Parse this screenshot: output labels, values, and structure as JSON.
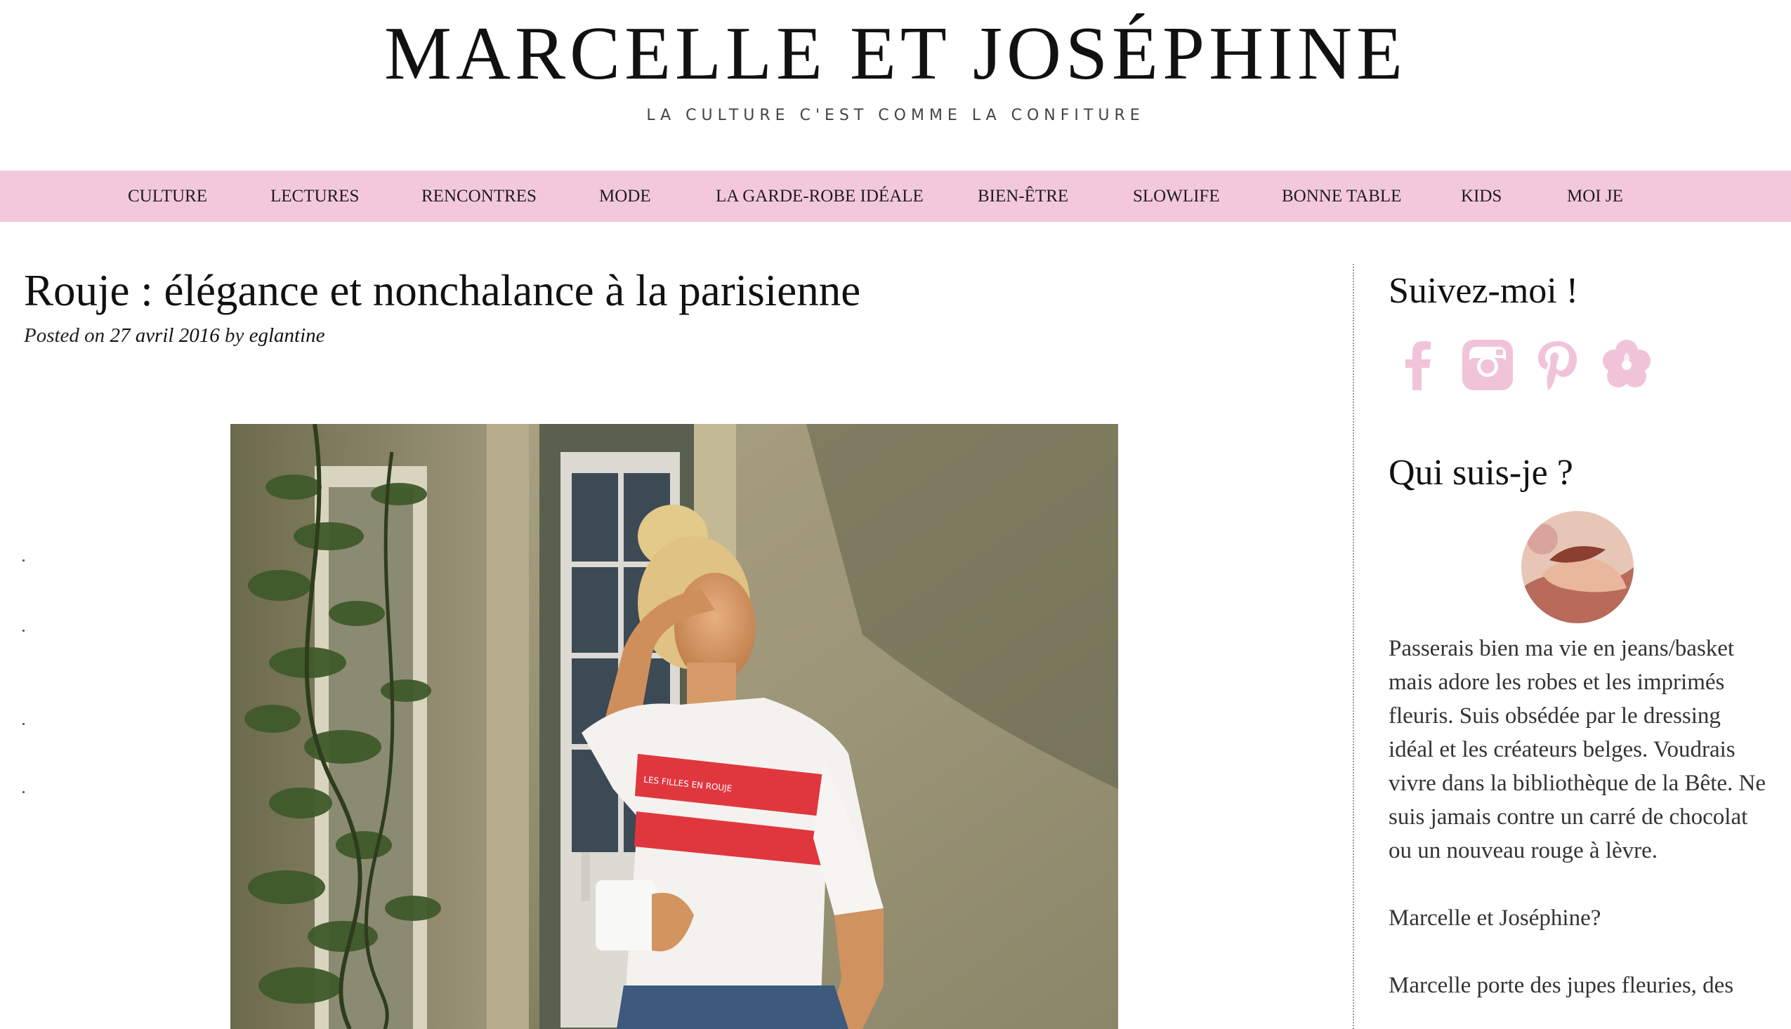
{
  "header": {
    "site_title": "MARCELLE ET JOSÉPHINE",
    "tagline": "LA CULTURE C'EST COMME LA CONFITURE"
  },
  "nav": {
    "items": [
      {
        "label": "CULTURE"
      },
      {
        "label": "LECTURES"
      },
      {
        "label": "RENCONTRES"
      },
      {
        "label": "MODE"
      },
      {
        "label": "LA GARDE-ROBE IDÉALE"
      },
      {
        "label": "BIEN-ÊTRE"
      },
      {
        "label": "SLOWLIFE"
      },
      {
        "label": "BONNE TABLE"
      },
      {
        "label": "KIDS"
      },
      {
        "label": "MOI JE"
      }
    ]
  },
  "article": {
    "title": "Rouje : élégance et nonchalance à la parisienne",
    "posted_on_label": "Posted on",
    "date": "27 avril 2016",
    "by_label": "by",
    "author": "eglantine",
    "hero_tshirt_print": "LES FILLES EN ROUJE"
  },
  "sidebar": {
    "follow_title": "Suivez-moi !",
    "social_icons": [
      "facebook-icon",
      "instagram-icon",
      "pinterest-icon",
      "hellocoton-icon"
    ],
    "about_title": "Qui suis-je ?",
    "about_paragraph_1": "Passerais bien ma vie en jeans/basket mais adore les robes et les imprimés fleuris. Suis obsédée par le dressing idéal et les créateurs belges. Voudrais vivre dans la bibliothèque de la Bête. Ne suis jamais contre un carré de chocolat ou un nouveau rouge à lèvre.",
    "about_paragraph_2": "Marcelle et Joséphine?",
    "about_paragraph_3": "Marcelle porte des jupes fleuries, des"
  },
  "colors": {
    "nav_background": "#f4c8dc",
    "social_pink": "#f1c3d9"
  }
}
